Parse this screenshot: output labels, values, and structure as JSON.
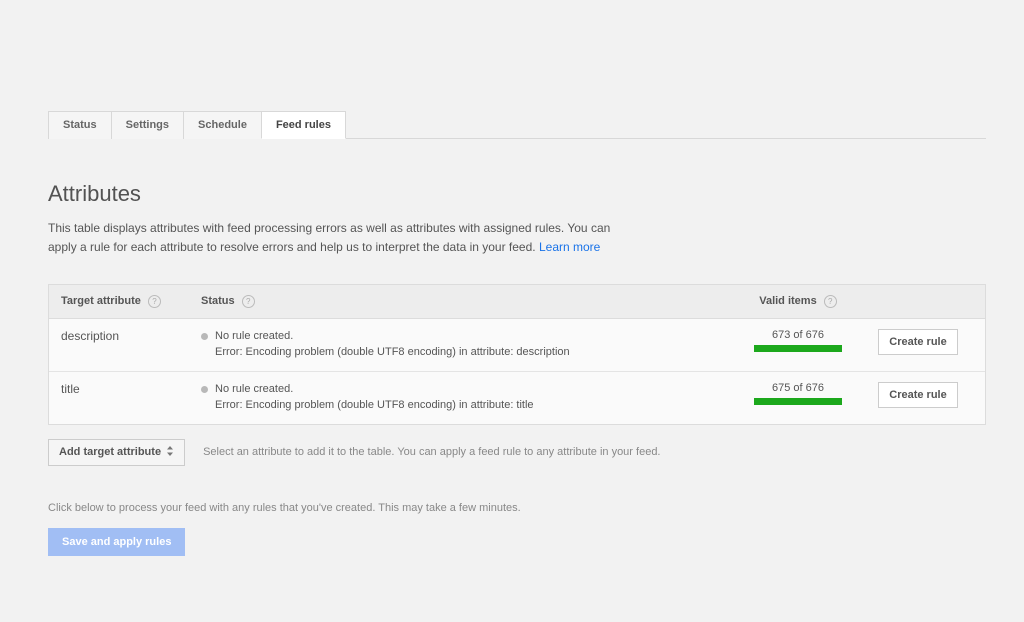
{
  "tabs": [
    {
      "label": "Status"
    },
    {
      "label": "Settings"
    },
    {
      "label": "Schedule"
    },
    {
      "label": "Feed rules"
    }
  ],
  "active_tab": 3,
  "title": "Attributes",
  "description_line1": "This table displays attributes with feed processing errors as well as attributes with assigned rules. You can",
  "description_line2": "apply a rule for each attribute to resolve errors and help us to interpret the data in your feed.",
  "learn_more": "Learn more",
  "table_headers": {
    "target_attribute": "Target attribute",
    "status": "Status",
    "valid_items": "Valid items"
  },
  "rows": [
    {
      "attribute": "description",
      "status_line1": "No rule created.",
      "status_line2": "Error: Encoding problem (double UTF8 encoding) in attribute: description",
      "valid_text": "673 of 676",
      "button": "Create rule"
    },
    {
      "attribute": "title",
      "status_line1": "No rule created.",
      "status_line2": "Error: Encoding problem (double UTF8 encoding) in attribute: title",
      "valid_text": "675 of 676",
      "button": "Create rule"
    }
  ],
  "add_button": "Add target attribute",
  "add_help": "Select an attribute to add it to the table. You can apply a feed rule to any attribute in your feed.",
  "process_text": "Click below to process your feed with any rules that you've created. This may take a few minutes.",
  "save_button": "Save and apply rules",
  "help_char": "?"
}
